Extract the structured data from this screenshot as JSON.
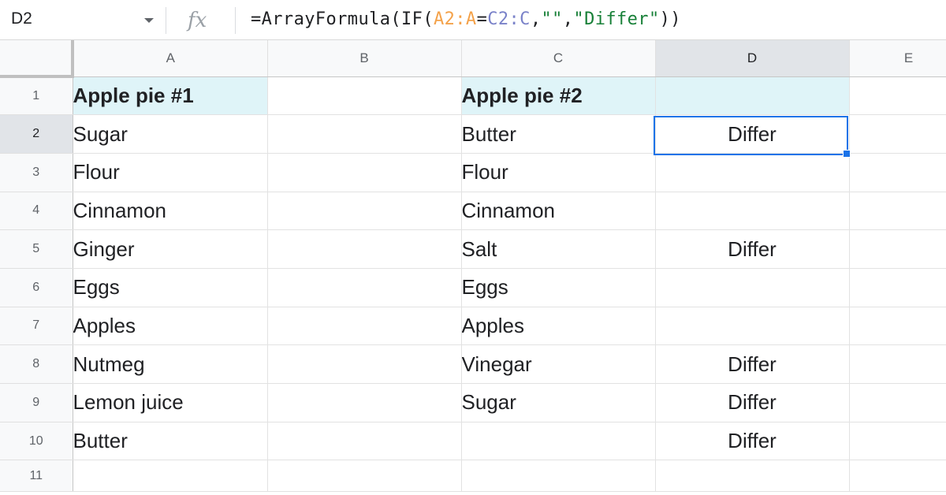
{
  "formula_bar": {
    "name_box": "D2",
    "formula_parts": [
      {
        "text": "=ArrayFormula(IF(",
        "color": "#202124"
      },
      {
        "text": "A2:A",
        "color": "#f4a24a"
      },
      {
        "text": "=",
        "color": "#202124"
      },
      {
        "text": "C2:C",
        "color": "#7a82c9"
      },
      {
        "text": ",",
        "color": "#202124"
      },
      {
        "text": "\"\"",
        "color": "#188038"
      },
      {
        "text": ",",
        "color": "#202124"
      },
      {
        "text": "\"Differ\"",
        "color": "#188038"
      },
      {
        "text": "))",
        "color": "#202124"
      }
    ]
  },
  "columns": [
    "A",
    "B",
    "C",
    "D",
    "E"
  ],
  "active_column": "D",
  "active_row": "2",
  "rows": [
    {
      "num": "1",
      "cells": [
        "Apple pie #1",
        "",
        "Apple pie #2",
        "",
        ""
      ]
    },
    {
      "num": "2",
      "cells": [
        "Sugar",
        "",
        "Butter",
        "Differ",
        ""
      ]
    },
    {
      "num": "3",
      "cells": [
        "Flour",
        "",
        "Flour",
        "",
        ""
      ]
    },
    {
      "num": "4",
      "cells": [
        "Cinnamon",
        "",
        "Cinnamon",
        "",
        ""
      ]
    },
    {
      "num": "5",
      "cells": [
        "Ginger",
        "",
        "Salt",
        "Differ",
        ""
      ]
    },
    {
      "num": "6",
      "cells": [
        "Eggs",
        "",
        "Eggs",
        "",
        ""
      ]
    },
    {
      "num": "7",
      "cells": [
        "Apples",
        "",
        "Apples",
        "",
        ""
      ]
    },
    {
      "num": "8",
      "cells": [
        "Nutmeg",
        "",
        "Vinegar",
        "Differ",
        ""
      ]
    },
    {
      "num": "9",
      "cells": [
        "Lemon juice",
        "",
        "Sugar",
        "Differ",
        ""
      ]
    },
    {
      "num": "10",
      "cells": [
        "Butter",
        "",
        "",
        "Differ",
        ""
      ]
    },
    {
      "num": "11",
      "cells": [
        "",
        "",
        "",
        "",
        ""
      ]
    }
  ],
  "colors": {
    "selection": "#1a73e8",
    "header_fill": "#dff4f8"
  }
}
